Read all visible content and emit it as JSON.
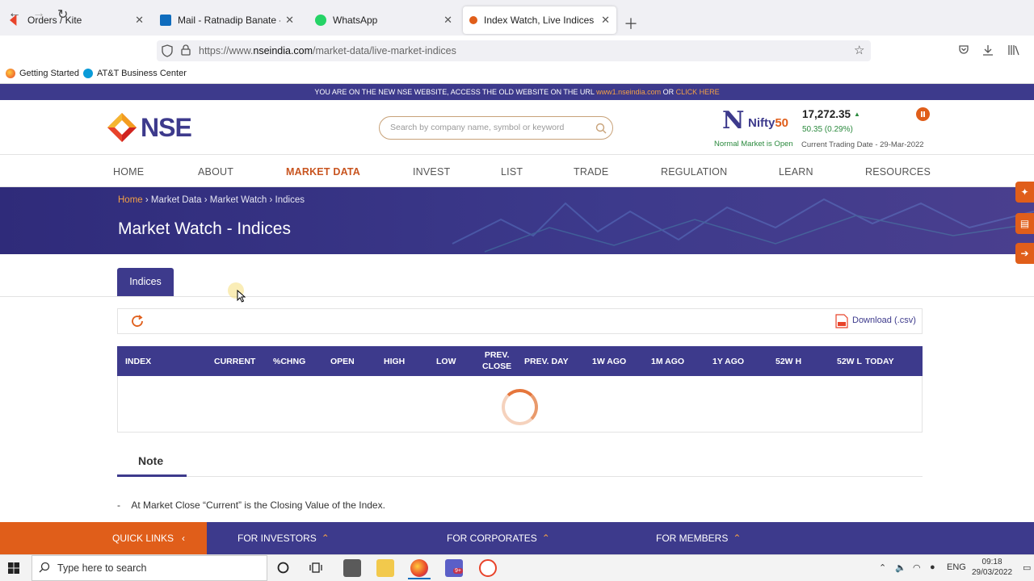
{
  "browser": {
    "tabs": [
      {
        "title": "Orders / Kite",
        "icon": "kite-icon"
      },
      {
        "title": "Mail - Ratnadip Banate - Outlook",
        "icon": "outlook-icon"
      },
      {
        "title": "WhatsApp",
        "icon": "whatsapp-icon"
      },
      {
        "title": "Index Watch, Live Indices Watch",
        "icon": "nse-icon"
      }
    ],
    "url_prefix": "https://www.",
    "url_domain": "nseindia.com",
    "url_path": "/market-data/live-market-indices",
    "bookmarks": [
      "Getting Started",
      "AT&T Business Center"
    ]
  },
  "notice": {
    "text": "YOU ARE ON THE NEW NSE WEBSITE, ACCESS THE OLD WEBSITE ON THE URL ",
    "link": "www1.nseindia.com",
    "or": " OR ",
    "click": "CLICK HERE"
  },
  "header": {
    "logo": "NSE",
    "search_placeholder": "Search by company name, symbol or keyword",
    "nifty_label": "Nifty",
    "nifty_num": "50",
    "nifty_value": "17,272.35",
    "nifty_change": "50.35 (0.29%)",
    "market_status": "Normal Market is Open",
    "trading_date": "Current Trading Date - 29-Mar-2022"
  },
  "menu": [
    "HOME",
    "ABOUT",
    "MARKET DATA",
    "INVEST",
    "LIST",
    "TRADE",
    "REGULATION",
    "LEARN",
    "RESOURCES"
  ],
  "breadcrumb": {
    "home": "Home",
    "sep": " › ",
    "items": [
      "Market Data",
      "Market Watch",
      "Indices"
    ]
  },
  "page_title": "Market Watch - Indices",
  "tab_label": "Indices",
  "download_label": "Download (.csv)",
  "table_headers": [
    "INDEX",
    "CURRENT",
    "%CHNG",
    "OPEN",
    "HIGH",
    "LOW",
    "PREV.",
    "CLOSE",
    "PREV. DAY",
    "1W AGO",
    "1M AGO",
    "1Y AGO",
    "52W H",
    "52W L",
    "TODAY"
  ],
  "note": {
    "title": "Note",
    "items": [
      "At Market Close “Current” is the Closing Value of the Index."
    ]
  },
  "footer": {
    "quick_links": "QUICK LINKS",
    "investors": "FOR INVESTORS",
    "corporates": "FOR CORPORATES",
    "members": "FOR MEMBERS"
  },
  "taskbar": {
    "search_placeholder": "Type here to search",
    "lang": "ENG",
    "time": "09:18",
    "date": "29/03/2022",
    "teams_badge": "9+"
  },
  "colors": {
    "brand": "#3d3a8c",
    "accent": "#e05e1a",
    "positive": "#2b8a3e"
  }
}
